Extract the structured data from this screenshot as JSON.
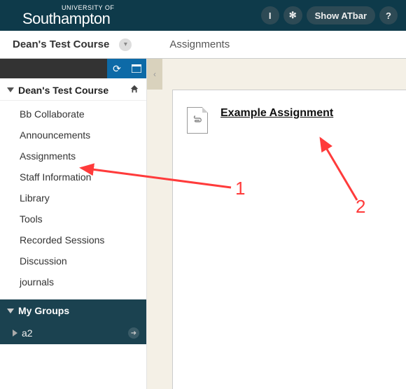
{
  "top": {
    "logo_small": "UNIVERSITY OF",
    "logo_big": "Southampton",
    "btn_info": "I",
    "btn_star": "✻",
    "btn_atbar": "Show ATbar",
    "btn_help": "?"
  },
  "breadcrumb": {
    "course": "Dean's Test Course",
    "page": "Assignments"
  },
  "sidebar": {
    "refresh": "⟳",
    "layout": "▭",
    "course_title": "Dean's Test Course",
    "items": [
      {
        "label": "Bb Collaborate"
      },
      {
        "label": "Announcements"
      },
      {
        "label": "Assignments"
      },
      {
        "label": "Staff Information"
      },
      {
        "label": "Library"
      },
      {
        "label": "Tools"
      },
      {
        "label": "Recorded Sessions"
      },
      {
        "label": "Discussion"
      },
      {
        "label": "journals"
      }
    ],
    "groups_title": "My Groups",
    "groups": [
      {
        "label": "a2"
      }
    ]
  },
  "content": {
    "assignment_title": "Example Assignment"
  },
  "annotations": {
    "one": "1",
    "two": "2"
  }
}
